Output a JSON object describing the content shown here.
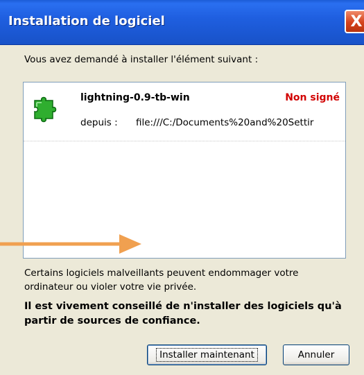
{
  "window": {
    "title": "Installation de logiciel",
    "close_label": "X"
  },
  "dialog": {
    "prompt": "Vous avez demandé à installer l'élément suivant :",
    "item": {
      "name": "lightning-0.9-tb-win",
      "status": "Non signé",
      "from_label": "depuis :",
      "from_url": "file:///C:/Documents%20and%20Settir",
      "icon": "puzzle-piece-icon"
    },
    "warning": "Certains logiciels malveillants peuvent endommager votre ordinateur ou violer votre vie privée.",
    "advice": "Il est vivement conseillé de n'installer des logiciels qu'à partir de sources de confiance."
  },
  "buttons": {
    "install": "Installer maintenant",
    "cancel": "Annuler"
  },
  "colors": {
    "titlebar": "#1f5fe0",
    "status_red": "#d20000",
    "arrow": "#f0a050"
  }
}
